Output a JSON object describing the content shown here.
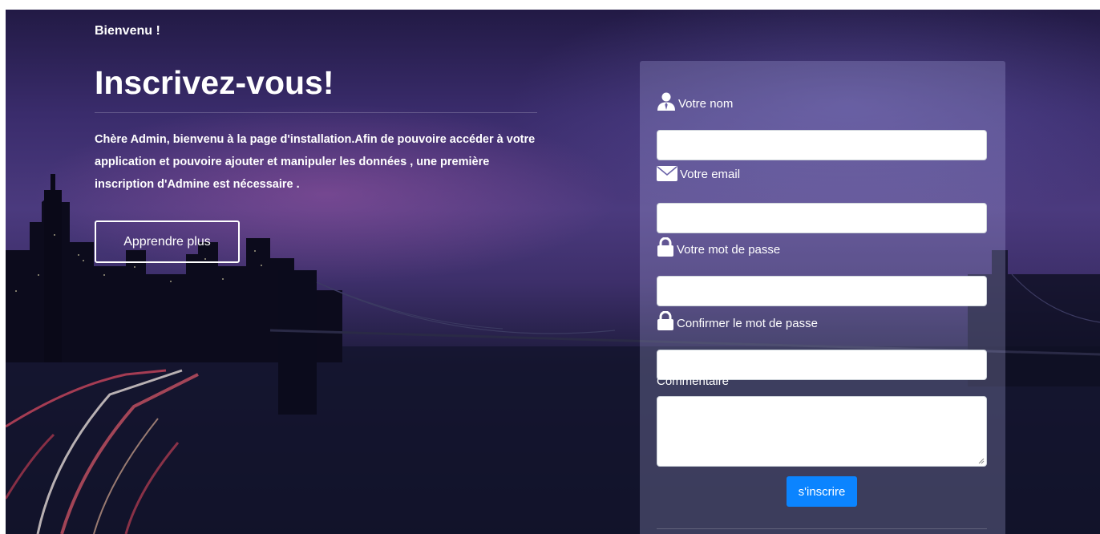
{
  "hero": {
    "welcome": "Bienvenu !",
    "title": "Inscrivez-vous!",
    "intro": "Chère Admin, bienvenu à la page d'installation.Afin de pouvoire accéder à votre application et pouvoire ajouter et manipuler les données , une première inscription d'Admine est nécessaire .",
    "learn_more": "Apprendre plus"
  },
  "form": {
    "name_label": "Votre nom",
    "name_value": "",
    "email_label": "Votre email",
    "email_value": "",
    "password_label": "Votre mot de passe",
    "password_value": "",
    "confirm_label": "Confirmer le mot de passe",
    "confirm_value": "",
    "comment_label": "Commentaire",
    "comment_value": "",
    "submit_label": "s'inscrire"
  },
  "icons": {
    "name": "user-icon",
    "email": "envelope-icon",
    "password": "lock-icon",
    "confirm": "lock-icon"
  },
  "colors": {
    "accent": "#0b84ff",
    "text": "#ffffff"
  }
}
